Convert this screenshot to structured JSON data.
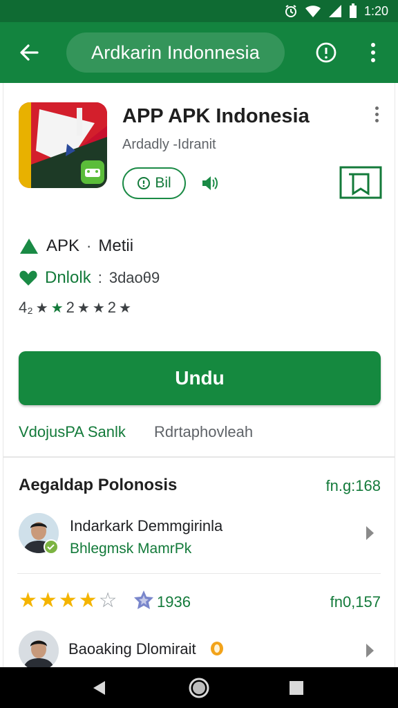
{
  "status_bar": {
    "time": "1:20"
  },
  "app_bar": {
    "search_text": "Ardkarin Indonnesia",
    "back_icon": "arrow-back-icon",
    "info_icon": "info-icon",
    "menu_icon": "more-vert-icon"
  },
  "app": {
    "title": "APP APK Indonesia",
    "developer": "Ardadly -Idranit",
    "chip_label": "Bil",
    "install_label": "Undu",
    "meta": [
      {
        "icon": "triangle-icon",
        "label": "APK",
        "separator": "·",
        "value": "Metii"
      },
      {
        "icon": "heart-icon",
        "label": "Dnlolk",
        "separator": ":",
        "value": "3daoθ9"
      }
    ],
    "rating_line": {
      "prefix": "4₂",
      "text1": "2",
      "text2": "2"
    },
    "links": {
      "primary": "VdojusPA Sanlk",
      "secondary": "Rdrtaphovleah"
    }
  },
  "section": {
    "title": "Aegaldap Polonosis",
    "count": "fn.g:168"
  },
  "reviews": [
    {
      "name": "Indarkark Demmgirinla",
      "sub": "Bhlegmsk MamrPk"
    },
    {
      "name": "Baoaking Dlomirait"
    }
  ],
  "rating_row": {
    "stars_filled": 4,
    "stars_total": 5,
    "badge_value": "1936",
    "count": "fn0,157"
  },
  "colors": {
    "primary": "#13843f",
    "status": "#0f6b33",
    "accent_text": "#137a3a",
    "star": "#f4b400"
  }
}
